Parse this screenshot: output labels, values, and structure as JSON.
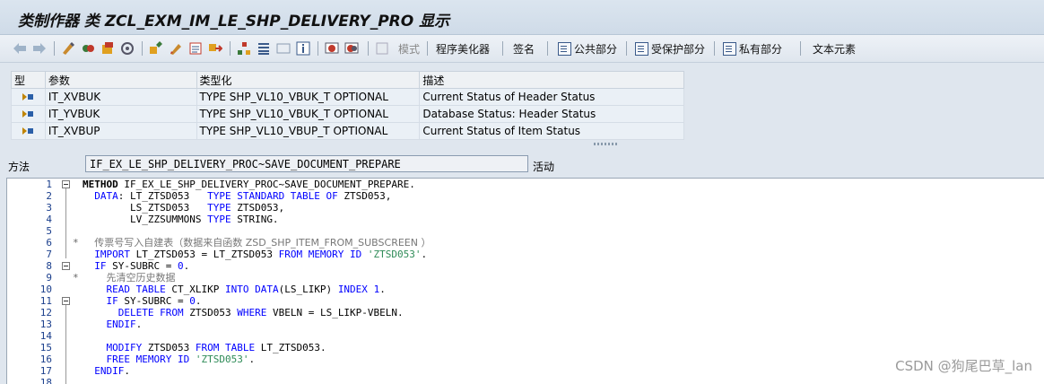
{
  "window": {
    "title": "类制作器 类 ZCL_EXM_IM_LE_SHP_DELIVERY_PRO 显示"
  },
  "toolbar": {
    "icons": [
      "back-arrow-icon",
      "forward-arrow-icon",
      "toggle-display-change-icon",
      "other-object-icon",
      "activate-icon",
      "where-used-icon",
      "check-icon",
      "pencil-icon",
      "object-list-icon",
      "navigation-icon",
      "hierarchy-icon",
      "stack-icon",
      "window-icon",
      "info-icon",
      "breakpoint-icon",
      "external-breakpoint-icon"
    ],
    "mode_label": "模式",
    "pretty_printer_label": "程序美化器",
    "signature_label": "签名",
    "public_section_label": "公共部分",
    "protected_section_label": "受保护部分",
    "private_section_label": "私有部分",
    "text_elements_label": "文本元素"
  },
  "params": {
    "headers": [
      "型",
      "参数",
      "类型化",
      "描述"
    ],
    "rows": [
      {
        "name": "IT_XVBUK",
        "typing": "TYPE SHP_VL10_VBUK_T OPTIONAL",
        "desc": "Current Status of Header Status"
      },
      {
        "name": "IT_YVBUK",
        "typing": "TYPE SHP_VL10_VBUK_T OPTIONAL",
        "desc": "Database Status: Header Status"
      },
      {
        "name": "IT_XVBUP",
        "typing": "TYPE SHP_VL10_VBUP_T OPTIONAL",
        "desc": "Current Status of Item Status"
      }
    ]
  },
  "method": {
    "label": "方法",
    "value": "IF_EX_LE_SHP_DELIVERY_PROC~SAVE_DOCUMENT_PREPARE",
    "status": "活动"
  },
  "editor": {
    "line_numbers": [
      "1",
      "2",
      "3",
      "4",
      "5",
      "6",
      "7",
      "8",
      "9",
      "10",
      "11",
      "12",
      "13",
      "14",
      "15",
      "16",
      "17",
      "18"
    ]
  },
  "watermark": "CSDN @狗尾巴草_lan",
  "colors": {
    "keyword": "#0000ff",
    "string": "#2e8b57",
    "comment": "#777777",
    "line_number": "#1a3e8c"
  }
}
